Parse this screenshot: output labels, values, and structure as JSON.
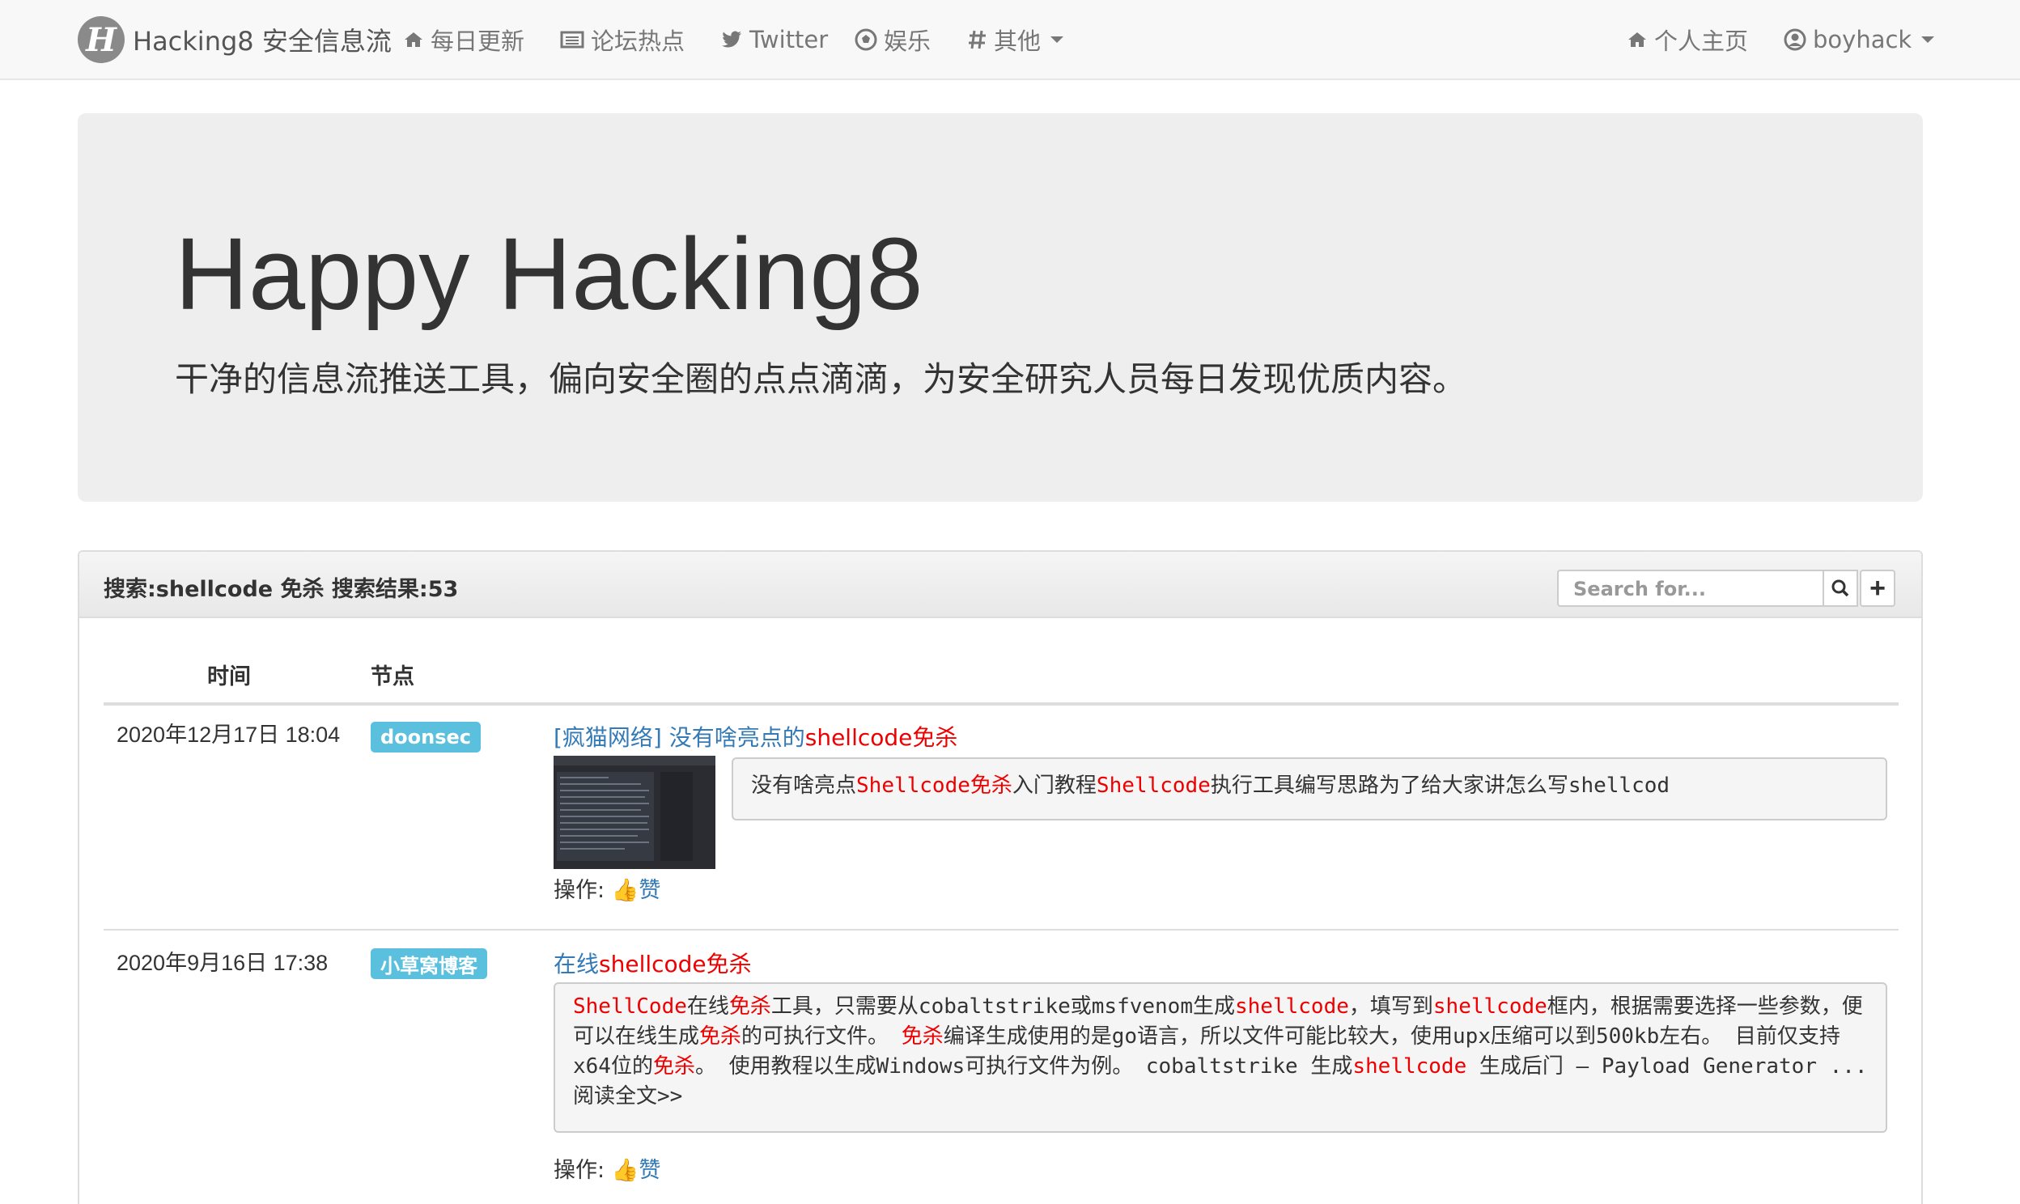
{
  "navbar": {
    "logo_letter": "H",
    "brand": "Hacking8 安全信息流",
    "items": [
      {
        "label": "每日更新",
        "icon": "home-icon"
      },
      {
        "label": "论坛热点",
        "icon": "newspaper-icon"
      },
      {
        "label": "Twitter",
        "icon": "twitter-icon"
      },
      {
        "label": "娱乐",
        "icon": "soccer-ball-icon"
      },
      {
        "label": "其他",
        "icon": "hashtag-icon"
      }
    ],
    "right_items": [
      {
        "label": "个人主页",
        "icon": "home-icon"
      },
      {
        "label": "boyhack",
        "icon": "user-circle-icon"
      }
    ]
  },
  "jumbotron": {
    "title": "Happy Hacking8",
    "subtitle": "干净的信息流推送工具，偏向安全圈的点点滴滴，为安全研究人员每日发现优质内容。"
  },
  "panel": {
    "title": "搜索:shellcode 免杀 搜索结果:53",
    "search_placeholder": "Search for...",
    "add_symbol": "+"
  },
  "table": {
    "headers": {
      "time": "时间",
      "node": "节点"
    },
    "rows": [
      {
        "date": "2020年12月17日 18:04",
        "node": "doonsec",
        "title_prefix": "[疯猫网络] 没有啥亮点的",
        "title_hl1": "shellcode",
        "title_hl2": "免杀",
        "summary": {
          "t1": "没有啥亮点",
          "h1": "Shellcode免杀",
          "t2": "入门教程",
          "h2": "Shellcode",
          "t3": "执行工具编写思路为了给大家讲怎么写shellcod"
        },
        "ops_label": "操作: ",
        "ops_emoji": "👍",
        "ops_like": "赞"
      },
      {
        "date": "2020年9月16日 17:38",
        "node": "小草窝博客",
        "title_prefix": "在线",
        "title_hl1": "shellcode",
        "title_hl2": "免杀",
        "summary": {
          "h1": "ShellCode",
          "t1": "在线",
          "h2": "免杀",
          "t2": "工具，只需要从cobaltstrike或msfvenom生成",
          "h3": "shellcode",
          "t3": "，填写到",
          "h4": "shellcode",
          "t4": "框内，根据需要选择一些参数，便可以在线生成",
          "h5": "免杀",
          "t5": "的可执行文件。 ",
          "h6": "免杀",
          "t6": "编译生成使用的是go语言，所以文件可能比较大，使用upx压缩可以到500kb左右。 目前仅支持x64位的",
          "h7": "免杀",
          "t7": "。 使用教程以生成Windows可执行文件为例。 cobaltstrike 生成",
          "h8": "shellcode",
          "t8": " 生成后门 – Payload Generator ...",
          "read_more": "阅读全文>>"
        },
        "ops_label": "操作: ",
        "ops_emoji": "👍",
        "ops_like": "赞"
      }
    ]
  },
  "colors": {
    "link": "#337ab7",
    "highlight": "#e00000",
    "label_bg": "#5bc0de",
    "navbar_bg": "#f8f8f8",
    "jumbotron_bg": "#eeeeee"
  }
}
